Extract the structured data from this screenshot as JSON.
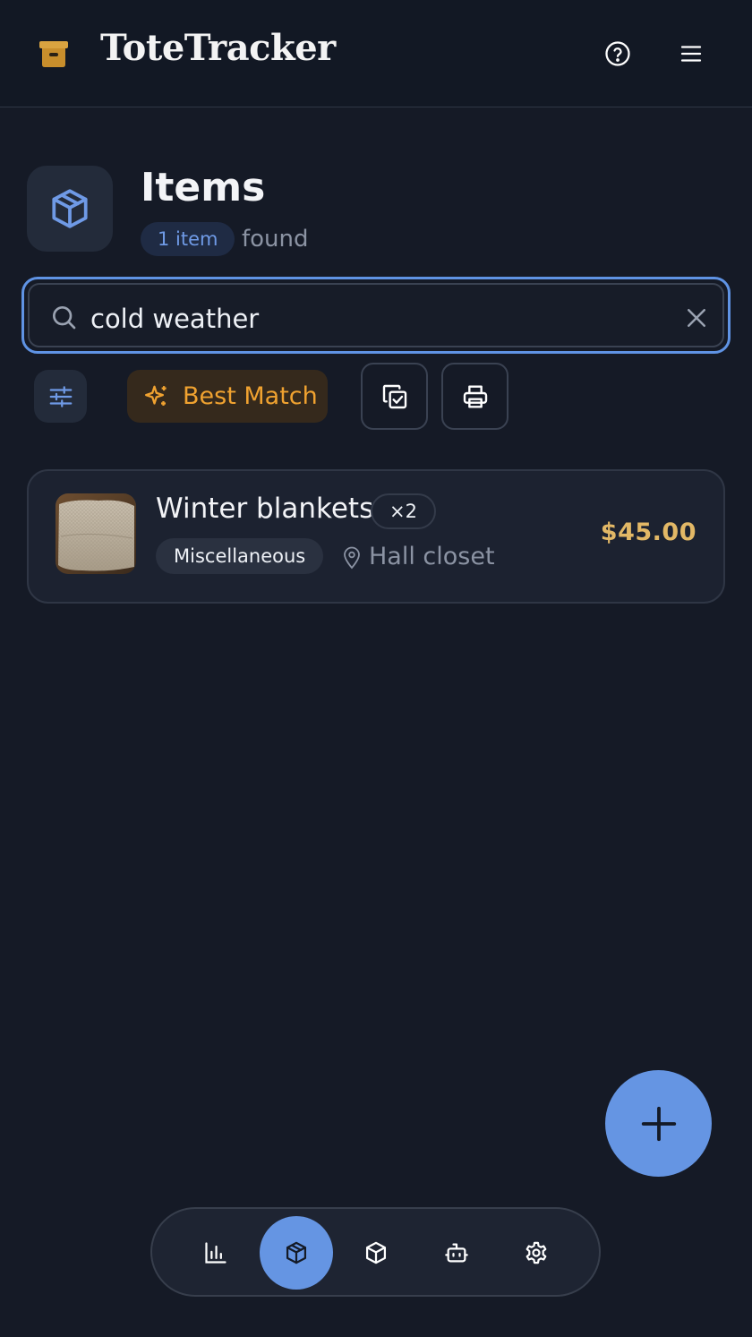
{
  "app": {
    "title": "ToteTracker"
  },
  "header": {
    "help_icon": "question-circle-icon",
    "menu_icon": "hamburger-menu-icon"
  },
  "page": {
    "title": "Items",
    "icon": "box-icon",
    "count_label": "1 item",
    "found_label": "found"
  },
  "search": {
    "value": "cold weather",
    "placeholder": "",
    "icon": "search-icon",
    "clear_icon": "close-icon"
  },
  "toolbar": {
    "filter_icon": "sliders-icon",
    "sort_label": "Best Match",
    "sort_icon": "sparkles-icon",
    "select_icon": "select-multiple-icon",
    "print_icon": "printer-icon"
  },
  "items": [
    {
      "name": "Winter blankets",
      "quantity": "×2",
      "category": "Miscellaneous",
      "location": "Hall closet",
      "price": "$45.00"
    }
  ],
  "fab": {
    "icon": "plus-icon"
  },
  "bottom_nav": {
    "items": [
      {
        "icon": "bar-chart-icon",
        "active": false
      },
      {
        "icon": "package-icon",
        "active": true
      },
      {
        "icon": "cube-icon",
        "active": false
      },
      {
        "icon": "robot-icon",
        "active": false
      },
      {
        "icon": "gear-icon",
        "active": false
      }
    ]
  },
  "colors": {
    "background": "#151a26",
    "accent": "#6595e3",
    "price": "#e2b866",
    "sort_accent": "#f0a230"
  }
}
